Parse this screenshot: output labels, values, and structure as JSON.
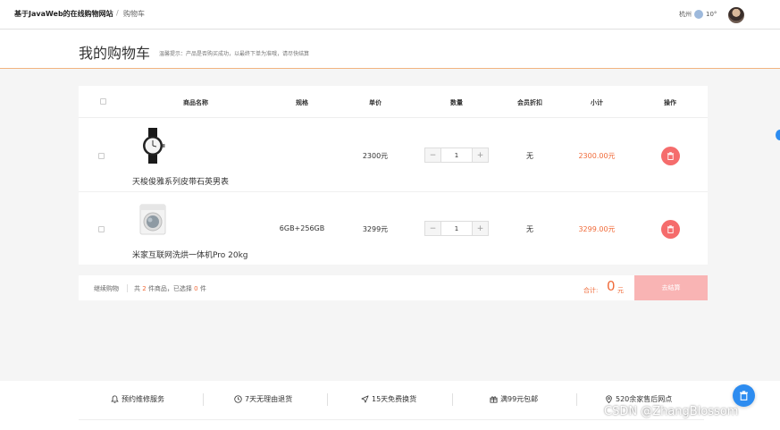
{
  "topbar": {
    "brand": "基于JavaWeb的在线购物网站",
    "separator": "/",
    "breadcrumb": "购物车",
    "city": "杭州",
    "temperature": "10°"
  },
  "header": {
    "title": "我的购物车",
    "tip": "温馨提示：产品是否购买成功，以最终下单为准哦，请尽快结算"
  },
  "table": {
    "columns": [
      "商品名称",
      "规格",
      "单价",
      "数量",
      "会员折扣",
      "小计",
      "操作"
    ],
    "rows": [
      {
        "name": "天梭俊雅系列皮带石英男表",
        "spec": "",
        "price": "2300元",
        "qty": "1",
        "discount": "无",
        "subtotal": "2300.00元",
        "image": "watch-image"
      },
      {
        "name": "米家互联网洗烘一体机Pro 20kg",
        "spec": "6GB+256GB",
        "price": "3299元",
        "qty": "1",
        "discount": "无",
        "subtotal": "3299.00元",
        "image": "washing-machine-image"
      }
    ],
    "minus": "−",
    "plus": "+"
  },
  "summary": {
    "continue": "继续购物",
    "count_prefix": "共",
    "count_total": "2",
    "count_mid": "件商品，已选择",
    "count_selected": "0",
    "count_suffix": "件",
    "total_label": "合计:",
    "total_value": "0",
    "total_unit": "元",
    "checkout": "去结算"
  },
  "footer": {
    "items": [
      "预约维修服务",
      "7天无理由退货",
      "15天免费换货",
      "满99元包邮",
      "520余家售后网点"
    ]
  },
  "watermark": "CSDN @ZhangBlossom",
  "colors": {
    "accent": "#f06b3a",
    "delete": "#f56c6c",
    "checkout": "#f9b4b4",
    "fab": "#2d8cf0"
  }
}
